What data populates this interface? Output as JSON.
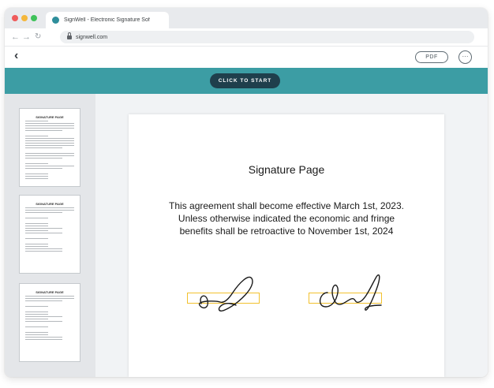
{
  "browser": {
    "tab_title": "SignWell - Electronic Signature Sof",
    "url": "signwell.com",
    "icons": [
      "back-arrow-icon",
      "forward-arrow-icon",
      "reload-icon",
      "lock-icon"
    ]
  },
  "toolbar": {
    "back_glyph": "‹",
    "pdf_label": "PDF",
    "more_glyph": "···"
  },
  "banner": {
    "cta_label": "CLICK TO START",
    "color": "#3c9da4"
  },
  "document": {
    "title": "Signature Page",
    "body_lines": [
      "This agreement shall become effective March 1st, 2023.",
      "Unless otherwise indicated the economic and fringe",
      "benefits shall be retroactive to November 1st, 2024"
    ]
  },
  "thumbnails": [
    {
      "title": "SIGNATURE PAGE"
    },
    {
      "title": "SIGNATURE PAGE"
    },
    {
      "title": "SIGNATURE PAGE"
    }
  ],
  "colors": {
    "signature_box": "#f2c12e",
    "cta_background": "#1f3f4c"
  }
}
